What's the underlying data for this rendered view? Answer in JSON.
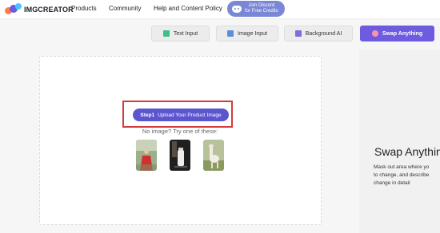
{
  "header": {
    "logo_text": "IMGCREATOR",
    "nav": [
      "Products",
      "Community",
      "Help and Content Policy"
    ],
    "discord_line1": "Join Discord",
    "discord_line2": "for Free Credits"
  },
  "modes": [
    {
      "label": "Text Input",
      "icon": "text-input-icon",
      "active": false
    },
    {
      "label": "Image Input",
      "icon": "image-input-icon",
      "active": false
    },
    {
      "label": "Background AI",
      "icon": "background-ai-icon",
      "active": false
    },
    {
      "label": "Swap Anything",
      "icon": "swap-anything-icon",
      "active": true
    }
  ],
  "upload": {
    "step_label": "Step1",
    "button_text": "Upload Your Product Image",
    "no_image_text": "No image? Try one of these:",
    "samples": [
      "sample-person-red-dress",
      "sample-bottle-product",
      "sample-alpaca"
    ]
  },
  "info": {
    "title": "Swap Anythin",
    "desc_line1": "Mask out area where yo",
    "desc_line2": "to change, and describe",
    "desc_line3": "change in detail"
  },
  "colors": {
    "accent": "#6e5ce0",
    "upload_button": "#5c55d0",
    "highlight_box": "#d23b3b",
    "discord": "#7a86d6"
  }
}
